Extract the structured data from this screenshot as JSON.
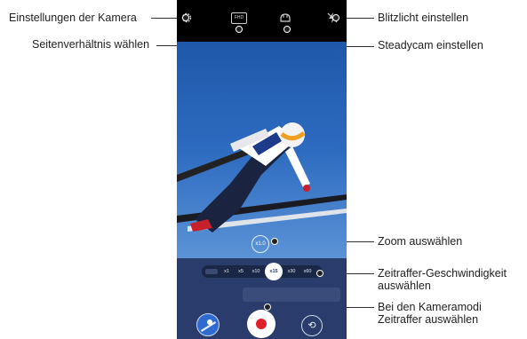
{
  "callouts": {
    "camera_settings": "Einstellungen der Kamera",
    "aspect_ratio": "Seitenverhältnis wählen",
    "flash": "Blitzlicht einstellen",
    "steadycam": "Steadycam einstellen",
    "zoom": "Zoom auswählen",
    "timelapse_speed_line1": "Zeitraffer-Geschwindigkeit",
    "timelapse_speed_line2": "auswählen",
    "camera_modes_line1": "Bei den Kameramodi",
    "camera_modes_line2": "Zeitraffer auswählen"
  },
  "topbar": {
    "settings_icon": "gear-icon",
    "aspect_label": "FHD",
    "steadycam_icon": "hand-icon",
    "flash_icon": "flash-off-icon"
  },
  "viewfinder": {
    "zoom_label": "x1.0"
  },
  "speeds": {
    "items": [
      "x1",
      "x5",
      "x10",
      "x15",
      "x30",
      "x60"
    ],
    "selected": "x15"
  },
  "controls": {
    "switch_icon": "camera-switch-icon"
  }
}
